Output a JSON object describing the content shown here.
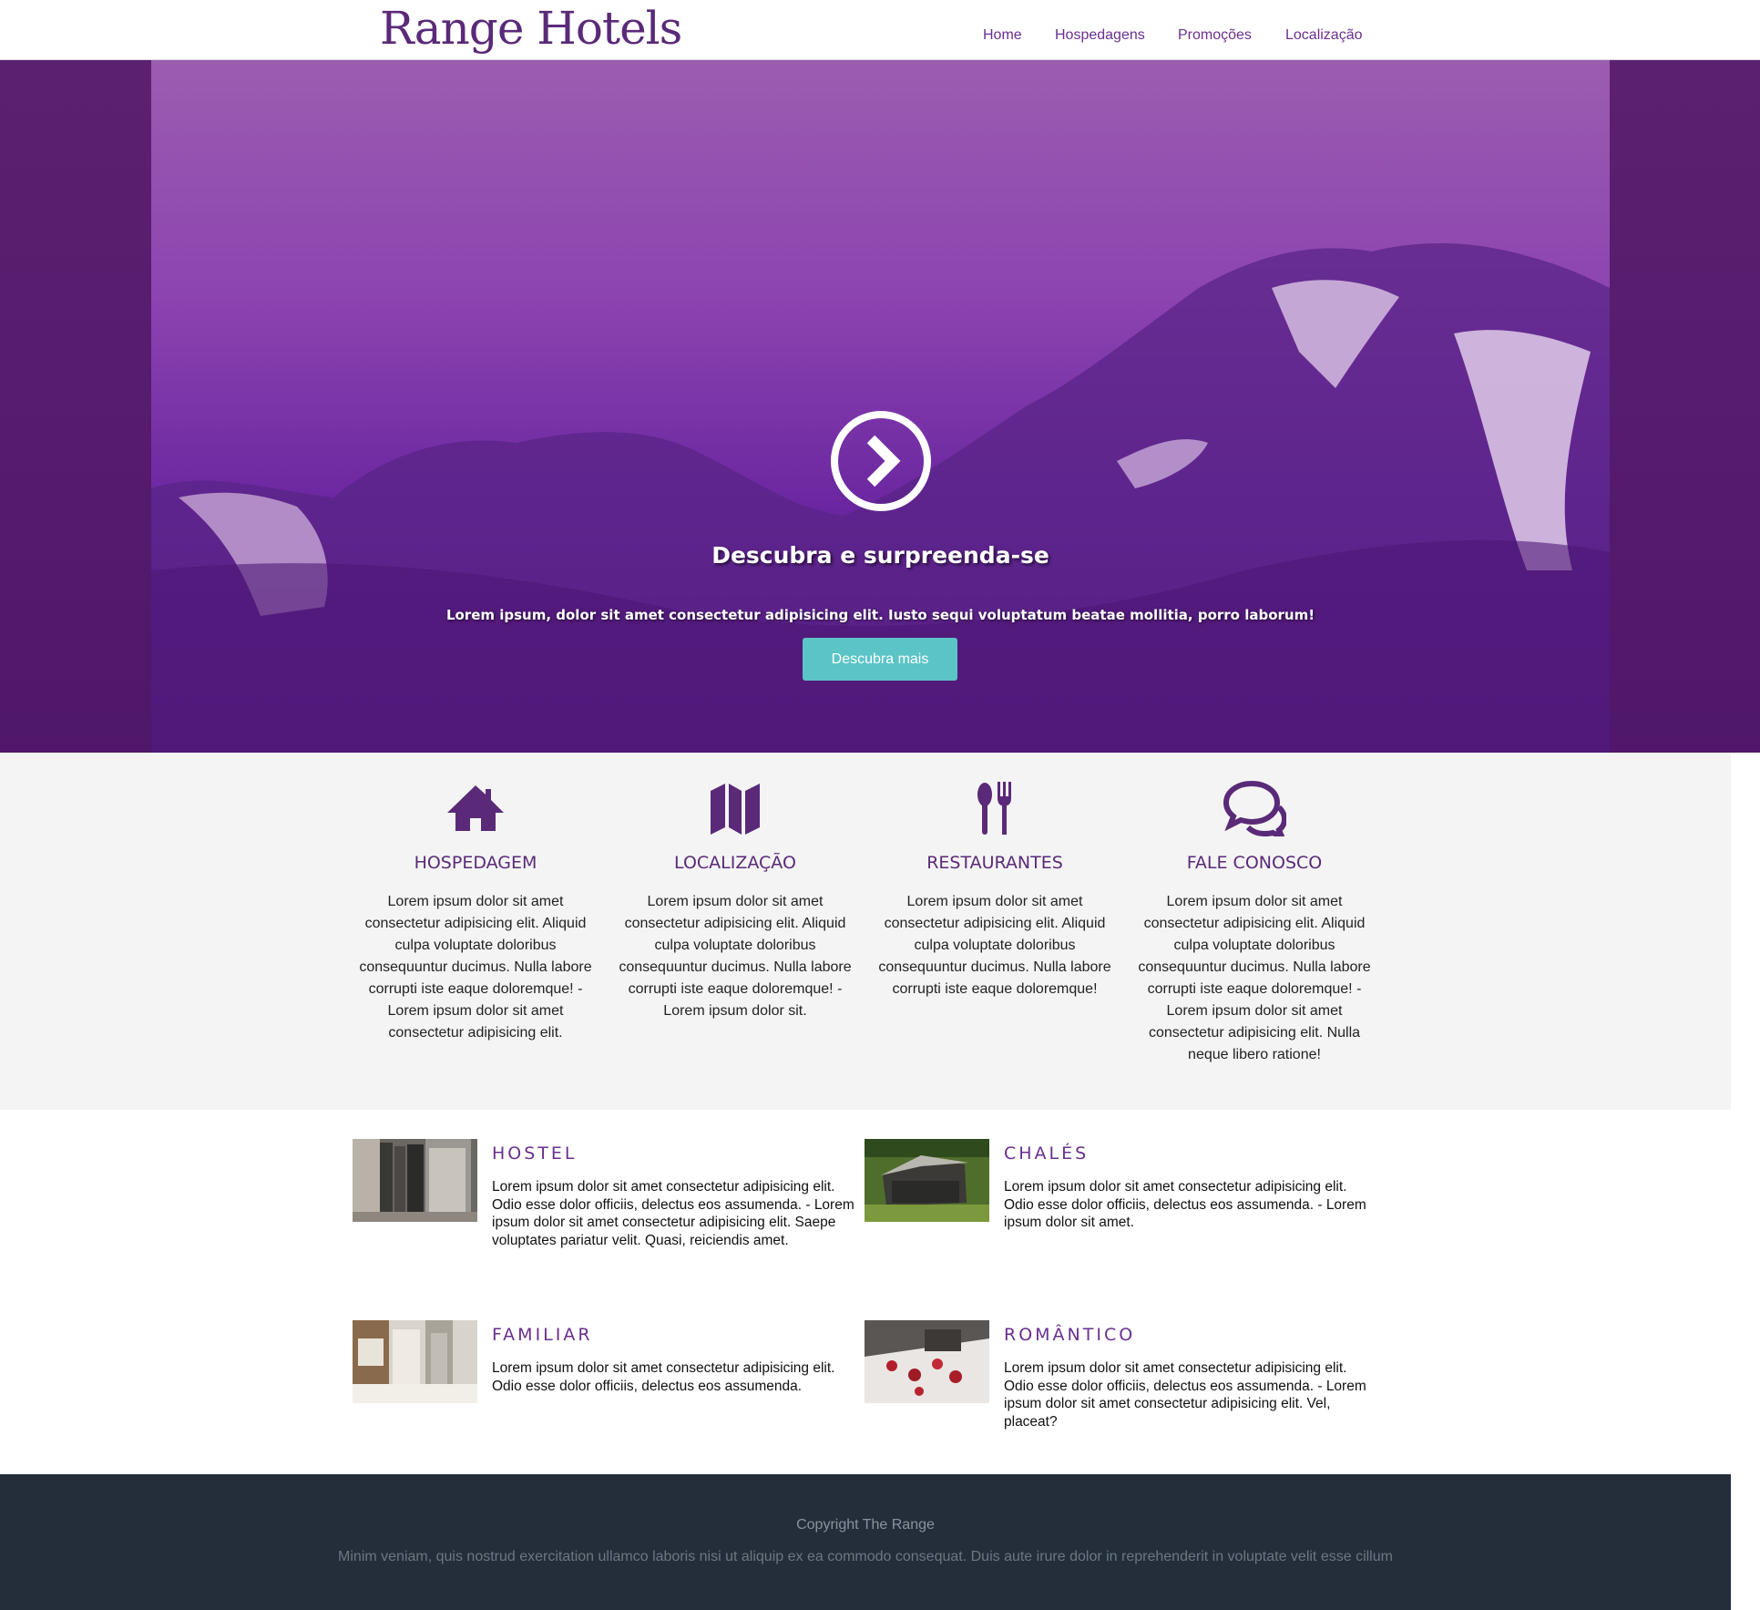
{
  "header": {
    "logo": "Range Hotels",
    "nav": [
      "Home",
      "Hospedagens",
      "Promoções",
      "Localização"
    ]
  },
  "hero": {
    "title": "Descubra e surpreenda-se",
    "subtitle": "Lorem ipsum, dolor sit amet consectetur adipisicing elit. Iusto sequi voluptatum beatae mollitia, porro laborum!",
    "button": "Descubra mais",
    "icon": "arrow-circle-right-icon"
  },
  "features": [
    {
      "icon": "home-icon",
      "title": "HOSPEDAGEM",
      "text": "Lorem ipsum dolor sit amet consectetur adipisicing elit. Aliquid culpa voluptate doloribus consequuntur ducimus. Nulla labore corrupti iste eaque doloremque! - Lorem ipsum dolor sit amet consectetur adipisicing elit."
    },
    {
      "icon": "map-icon",
      "title": "LOCALIZAÇÃO",
      "text": "Lorem ipsum dolor sit amet consectetur adipisicing elit. Aliquid culpa voluptate doloribus consequuntur ducimus. Nulla labore corrupti iste eaque doloremque! - Lorem ipsum dolor sit."
    },
    {
      "icon": "cutlery-icon",
      "title": "RESTAURANTES",
      "text": "Lorem ipsum dolor sit amet consectetur adipisicing elit. Aliquid culpa voluptate doloribus consequuntur ducimus. Nulla labore corrupti iste eaque doloremque!"
    },
    {
      "icon": "chat-bubbles-icon",
      "title": "FALE CONOSCO",
      "text": "Lorem ipsum dolor sit amet consectetur adipisicing elit. Aliquid culpa voluptate doloribus consequuntur ducimus. Nulla labore corrupti iste eaque doloremque! - Lorem ipsum dolor sit amet consectetur adipisicing elit. Nulla neque libero ratione!"
    }
  ],
  "categories": [
    {
      "title": "HOSTEL",
      "text": "Lorem ipsum dolor sit amet consectetur adipisicing elit. Odio esse dolor officiis, delectus eos assumenda. - Lorem ipsum dolor sit amet consectetur adipisicing elit. Saepe voluptates pariatur velit. Quasi, reiciendis amet."
    },
    {
      "title": "CHALÉS",
      "text": "Lorem ipsum dolor sit amet consectetur adipisicing elit. Odio esse dolor officiis, delectus eos assumenda. - Lorem ipsum dolor sit amet."
    },
    {
      "title": "FAMILIAR",
      "text": "Lorem ipsum dolor sit amet consectetur adipisicing elit. Odio esse dolor officiis, delectus eos assumenda."
    },
    {
      "title": "ROMÂNTICO",
      "text": "Lorem ipsum dolor sit amet consectetur adipisicing elit. Odio esse dolor officiis, delectus eos assumenda. - Lorem ipsum dolor sit amet consectetur adipisicing elit. Vel, placeat?"
    }
  ],
  "footer": {
    "copyright": "Copyright The Range",
    "text": "Minim veniam, quis nostrud exercitation ullamco laboris nisi ut aliquip ex ea commodo consequat. Duis aute irure dolor in reprehenderit in voluptate velit esse cillum"
  },
  "colors": {
    "brand": "#5a2a78",
    "accent": "#5bc4c6",
    "footer": "#232e3a"
  }
}
